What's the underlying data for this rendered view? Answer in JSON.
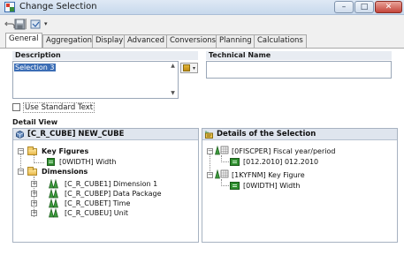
{
  "window": {
    "title": "Change Selection",
    "controls": {
      "minimize": "–",
      "maximize": "□",
      "close": "✕"
    }
  },
  "toolbar": {
    "icons": [
      "undo-icon",
      "save-icon",
      "dropdown-menu-icon"
    ]
  },
  "tabs": [
    {
      "label": "General",
      "active": true
    },
    {
      "label": "Aggregation"
    },
    {
      "label": "Display"
    },
    {
      "label": "Advanced"
    },
    {
      "label": "Conversions"
    },
    {
      "label": "Planning"
    },
    {
      "label": "Calculations"
    }
  ],
  "description": {
    "label": "Description",
    "value": "Selection 3"
  },
  "technical_name": {
    "label": "Technical Name",
    "value": ""
  },
  "use_standard_text": {
    "label": "Use Standard Text",
    "checked": false
  },
  "detail_view": {
    "label": "Detail View",
    "left_tree": {
      "header": "[C_R_CUBE] NEW_CUBE",
      "nodes": [
        {
          "label": "Key Figures"
        },
        {
          "label": "[0WIDTH] Width"
        },
        {
          "label": "Dimensions"
        },
        {
          "label": "[C_R_CUBE1] Dimension 1"
        },
        {
          "label": "[C_R_CUBEP] Data Package"
        },
        {
          "label": "[C_R_CUBET] Time"
        },
        {
          "label": "[C_R_CUBEU] Unit"
        }
      ]
    },
    "right_tree": {
      "header": "Details of the Selection",
      "nodes": [
        {
          "label": "[0FISCPER] Fiscal year/period"
        },
        {
          "label": "[012.2010] 012.2010"
        },
        {
          "label": "[1KYFNM] Key Figure"
        },
        {
          "label": "[0WIDTH] Width"
        }
      ]
    }
  },
  "colors": {
    "selection": "#3b6db5",
    "key_figure": "#2e8b2e",
    "folder": "#e9b84a"
  }
}
